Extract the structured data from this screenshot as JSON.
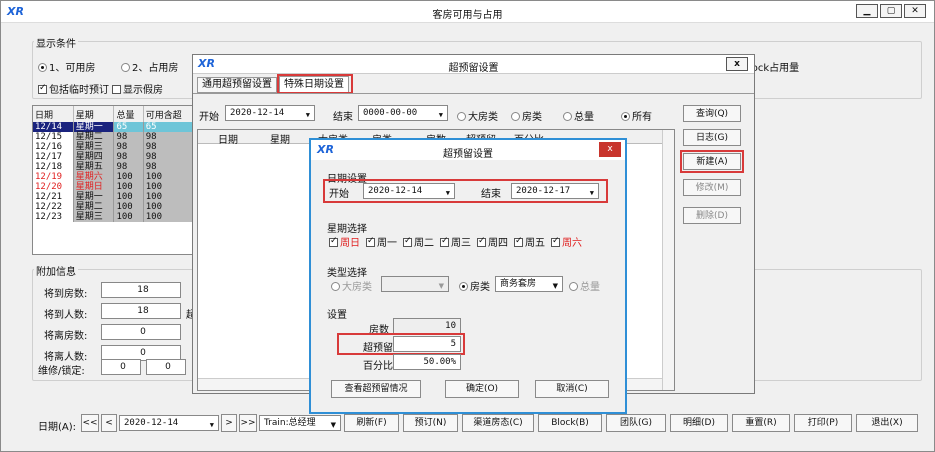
{
  "main": {
    "title": "客房可用与占用",
    "display_conditions": "显示条件",
    "radio1": "1、可用房",
    "radio2": "2、占用房",
    "block_label": "lock占用量",
    "check_temp": "包括临时预订",
    "check_fake": "显示假房",
    "grid_headers": [
      "日期",
      "星期",
      "总量",
      "可用含超"
    ],
    "grid_rows": [
      {
        "date": "12/14",
        "weekday": "星期一",
        "total": "65",
        "avail": "65"
      },
      {
        "date": "12/15",
        "weekday": "星期二",
        "total": "98",
        "avail": "98"
      },
      {
        "date": "12/16",
        "weekday": "星期三",
        "total": "98",
        "avail": "98"
      },
      {
        "date": "12/17",
        "weekday": "星期四",
        "total": "98",
        "avail": "98"
      },
      {
        "date": "12/18",
        "weekday": "星期五",
        "total": "98",
        "avail": "98"
      },
      {
        "date": "12/19",
        "weekday": "星期六",
        "total": "100",
        "avail": "100"
      },
      {
        "date": "12/20",
        "weekday": "星期日",
        "total": "100",
        "avail": "100"
      },
      {
        "date": "12/21",
        "weekday": "星期一",
        "total": "100",
        "avail": "100"
      },
      {
        "date": "12/22",
        "weekday": "星期二",
        "total": "100",
        "avail": "100"
      },
      {
        "date": "12/23",
        "weekday": "星期三",
        "total": "100",
        "avail": "100"
      }
    ],
    "extra_info": "附加信息",
    "arrive_rooms_label": "将到房数:",
    "arrive_rooms": "18",
    "arrive_people_label": "将到人数:",
    "arrive_people": "18",
    "arrive_people_suffix": "超",
    "depart_rooms_label": "将离房数:",
    "depart_rooms": "0",
    "depart_people_label": "将离人数:",
    "depart_people": "0",
    "maint_label": "维修/锁定:",
    "maint_a": "0",
    "maint_b": "0",
    "date_label": "日期(A):",
    "nav_first": "<<",
    "nav_prev": "<",
    "date_value": "2020-12-14",
    "nav_next": ">",
    "nav_last": ">>",
    "train_label": "Train:总经理",
    "btn_refresh": "刷新(F)",
    "btn_book": "预订(N)",
    "btn_channel": "渠道房态(C)",
    "btn_block": "Block(B)",
    "btn_group": "团队(G)",
    "btn_detail": "明细(D)",
    "btn_reset": "重置(R)",
    "btn_print": "打印(P)",
    "btn_exit": "退出(X)"
  },
  "overbook": {
    "title": "超预留设置",
    "close": "x",
    "tab_general": "通用超预留设置",
    "tab_special": "特殊日期设置",
    "start_label": "开始",
    "start_value": "2020-12-14",
    "end_label": "结束",
    "end_value": "0000-00-00",
    "radio_bigtype": "大房类",
    "radio_type": "房类",
    "radio_total": "总量",
    "radio_all": "所有",
    "cols": [
      "日期",
      "星期",
      "大房类",
      "房类",
      "房数",
      "超预留",
      "百分比"
    ],
    "btn_query": "查询(Q)",
    "btn_log": "日志(G)",
    "btn_new": "新建(A)",
    "btn_modify": "修改(M)",
    "btn_delete": "删除(D)"
  },
  "inner": {
    "title": "超预留设置",
    "close": "x",
    "date_settings": "日期设置",
    "start_label": "开始",
    "start_value": "2020-12-14",
    "end_label": "结束",
    "end_value": "2020-12-17",
    "weekday_select": "星期选择",
    "weekdays": [
      "周日",
      "周一",
      "周二",
      "周三",
      "周四",
      "周五",
      "周六"
    ],
    "type_select": "类型选择",
    "type_big": "大房类",
    "type_room": "房类",
    "type_room_value": "商务套房",
    "type_total": "总量",
    "settings": "设置",
    "rooms_label": "房数",
    "rooms_value": "10",
    "over_label": "超预留",
    "over_value": "5",
    "pct_label": "百分比",
    "pct_value": "50.00%",
    "btn_view": "查看超预留情况",
    "btn_ok": "确定(O)",
    "btn_cancel": "取消(C)"
  },
  "colors": {
    "highlight": "#d83a3a",
    "logo": "#1e64d8",
    "dlg_border": "#2f8fd6",
    "selected_row": "#6ec5d8"
  }
}
